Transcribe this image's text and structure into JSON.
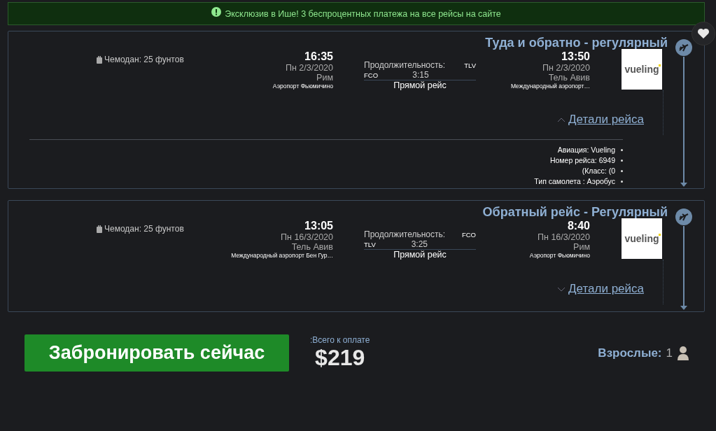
{
  "banner": {
    "text": "Эксклюзив в Ише! 3 беспроцентных платежа на все рейсы на сайте"
  },
  "flights": [
    {
      "title": "Туда и обратно - регулярный",
      "baggage": "Чемодан: 25 фунтов",
      "departure": {
        "time": "16:35",
        "date": "Пн 2/3/2020",
        "city": "Рим",
        "airport": "Аэропорт Фьюмичино"
      },
      "duration_label": "Продолжительность:",
      "duration": "3:15",
      "origin_code": "FCO",
      "dest_code": "TLV",
      "flight_type": "Прямой рейс",
      "arrival": {
        "time": "13:50",
        "date": "Пн 2/3/2020",
        "city": "Тель Авив",
        "airport": "Международный аэропорт…"
      },
      "airline_logo": "vueling",
      "details_link": "Детали рейса",
      "expanded": true,
      "details": [
        "Авиация: Vueling",
        "Номер рейса: 6949",
        "(Класс: (0",
        "Тип самолета : Аэробус"
      ]
    },
    {
      "title": "Обратный рейс - Регулярный",
      "baggage": "Чемодан: 25 фунтов",
      "departure": {
        "time": "13:05",
        "date": "Пн 16/3/2020",
        "city": "Тель Авив",
        "airport": "Международный аэропорт Бен Гур…"
      },
      "duration_label": "Продолжительность:",
      "duration": "3:25",
      "origin_code": "TLV",
      "dest_code": "FCO",
      "flight_type": "Прямой рейс",
      "arrival": {
        "time": "8:40",
        "date": "Пн 16/3/2020",
        "city": "Рим",
        "airport": "Аэропорт Фьюмичино"
      },
      "airline_logo": "vueling",
      "details_link": "Детали рейса",
      "expanded": false
    }
  ],
  "footer": {
    "book_button": "Забронировать сейчас",
    "total_label": ":Всего к оплате",
    "total": "$219",
    "adults_label": "Взрослые:",
    "adults": "1"
  }
}
